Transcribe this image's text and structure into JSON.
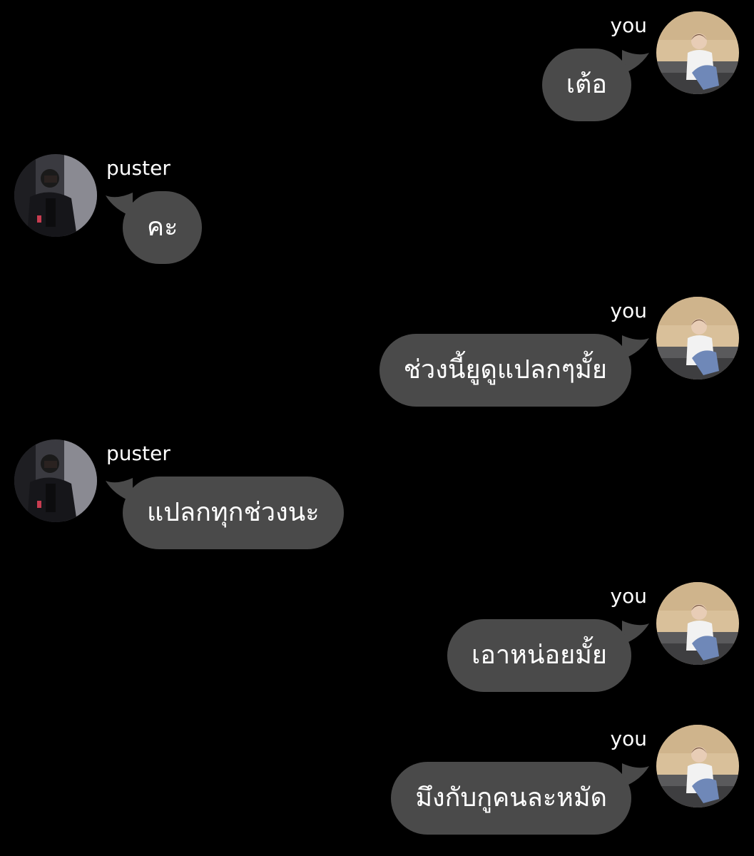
{
  "chat": {
    "colors": {
      "background": "#000000",
      "bubble": "#4a4a4a",
      "text": "#ffffff"
    },
    "messages": [
      {
        "sender": "you",
        "side": "right",
        "text": "เต้อ",
        "avatar": "avatar-you-icon"
      },
      {
        "sender": "puster",
        "side": "left",
        "text": "คะ",
        "avatar": "avatar-puster-icon"
      },
      {
        "sender": "you",
        "side": "right",
        "text": "ช่วงนี้ยูดูแปลกๆมั้ย",
        "avatar": "avatar-you-icon"
      },
      {
        "sender": "puster",
        "side": "left",
        "text": "แปลกทุกช่วงนะ",
        "avatar": "avatar-puster-icon"
      },
      {
        "sender": "you",
        "side": "right",
        "text": "เอาหน่อยมั้ย",
        "avatar": "avatar-you-icon"
      },
      {
        "sender": "you",
        "side": "right",
        "text": "มึงกับกูคนละหมัด",
        "avatar": "avatar-you-icon"
      }
    ]
  }
}
